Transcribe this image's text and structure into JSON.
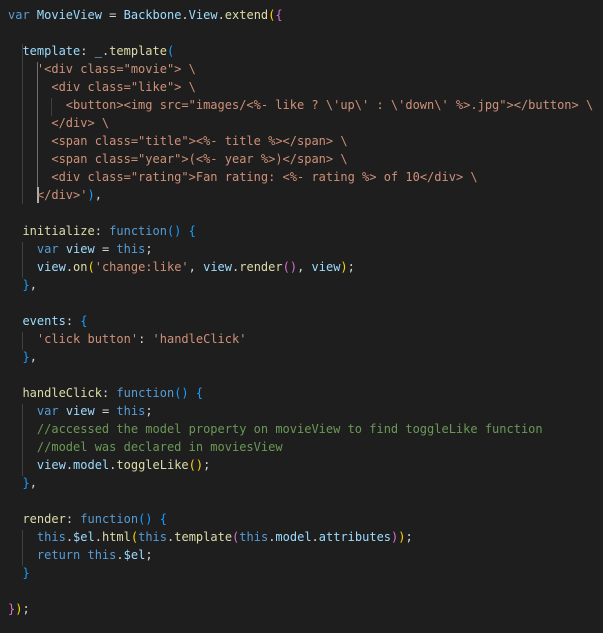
{
  "editor": {
    "language": "javascript",
    "theme": {
      "background": "#1e1e1e",
      "keyword": "#569cd6",
      "function": "#dcdcaa",
      "variable": "#9cdcfe",
      "string": "#ce9178",
      "comment": "#6a9955",
      "bracket_level1": "#ffd700",
      "bracket_level2": "#da70d6",
      "bracket_level3": "#179fff",
      "text": "#d4d4d4"
    },
    "lines": [
      [
        [
          "kw",
          "var "
        ],
        [
          "var",
          "MovieView"
        ],
        [
          "plain",
          " = "
        ],
        [
          "var",
          "Backbone"
        ],
        [
          "plain",
          "."
        ],
        [
          "var",
          "View"
        ],
        [
          "plain",
          "."
        ],
        [
          "fn",
          "extend"
        ],
        [
          "bracket",
          "("
        ],
        [
          "brace2",
          "{"
        ]
      ],
      [],
      [
        [
          "plain",
          "  "
        ],
        [
          "prop",
          "template"
        ],
        [
          "plain",
          ": "
        ],
        [
          "var",
          "_"
        ],
        [
          "plain",
          "."
        ],
        [
          "fn",
          "template"
        ],
        [
          "brace3",
          "("
        ]
      ],
      [
        [
          "plain",
          "    "
        ],
        [
          "str",
          "'<div class=\"movie\"> \\"
        ]
      ],
      [
        [
          "plain",
          "      "
        ],
        [
          "str",
          "<div class=\"like\"> \\"
        ]
      ],
      [
        [
          "plain",
          "        "
        ],
        [
          "str",
          "<button><img src=\"images/<%- like ? \\'up\\' : \\'down\\' %>.jpg\"></button> \\"
        ]
      ],
      [
        [
          "plain",
          "      "
        ],
        [
          "str",
          "</div> \\"
        ]
      ],
      [
        [
          "plain",
          "      "
        ],
        [
          "str",
          "<span class=\"title\"><%- title %></span> \\"
        ]
      ],
      [
        [
          "plain",
          "      "
        ],
        [
          "str",
          "<span class=\"year\">(<%- year %>)</span> \\"
        ]
      ],
      [
        [
          "plain",
          "      "
        ],
        [
          "str",
          "<div class=\"rating\">Fan rating: <%- rating %> of 10</div> \\"
        ]
      ],
      [
        [
          "plain",
          "    "
        ],
        [
          "str",
          "</div>'"
        ],
        [
          "brace3",
          ")"
        ],
        [
          "plain",
          ","
        ]
      ],
      [],
      [
        [
          "plain",
          "  "
        ],
        [
          "fn",
          "initialize"
        ],
        [
          "plain",
          ": "
        ],
        [
          "kw",
          "function"
        ],
        [
          "brace3",
          "()"
        ],
        [
          "plain",
          " "
        ],
        [
          "brace3",
          "{"
        ]
      ],
      [
        [
          "plain",
          "    "
        ],
        [
          "kw",
          "var "
        ],
        [
          "var",
          "view"
        ],
        [
          "plain",
          " = "
        ],
        [
          "kw",
          "this"
        ],
        [
          "plain",
          ";"
        ]
      ],
      [
        [
          "plain",
          "    "
        ],
        [
          "var",
          "view"
        ],
        [
          "plain",
          "."
        ],
        [
          "fn",
          "on"
        ],
        [
          "bracket",
          "("
        ],
        [
          "str",
          "'change:like'"
        ],
        [
          "plain",
          ", "
        ],
        [
          "var",
          "view"
        ],
        [
          "plain",
          "."
        ],
        [
          "fn",
          "render"
        ],
        [
          "brace2",
          "()"
        ],
        [
          "plain",
          ", "
        ],
        [
          "var",
          "view"
        ],
        [
          "bracket",
          ")"
        ],
        [
          "plain",
          ";"
        ]
      ],
      [
        [
          "plain",
          "  "
        ],
        [
          "brace3",
          "}"
        ],
        [
          "plain",
          ","
        ]
      ],
      [],
      [
        [
          "plain",
          "  "
        ],
        [
          "prop",
          "events"
        ],
        [
          "plain",
          ": "
        ],
        [
          "brace3",
          "{"
        ]
      ],
      [
        [
          "plain",
          "    "
        ],
        [
          "str",
          "'click button'"
        ],
        [
          "plain",
          ": "
        ],
        [
          "str",
          "'handleClick'"
        ]
      ],
      [
        [
          "plain",
          "  "
        ],
        [
          "brace3",
          "}"
        ],
        [
          "plain",
          ","
        ]
      ],
      [],
      [
        [
          "plain",
          "  "
        ],
        [
          "fn",
          "handleClick"
        ],
        [
          "plain",
          ": "
        ],
        [
          "kw",
          "function"
        ],
        [
          "brace3",
          "()"
        ],
        [
          "plain",
          " "
        ],
        [
          "brace3",
          "{"
        ]
      ],
      [
        [
          "plain",
          "    "
        ],
        [
          "kw",
          "var "
        ],
        [
          "var",
          "view"
        ],
        [
          "plain",
          " = "
        ],
        [
          "kw",
          "this"
        ],
        [
          "plain",
          ";"
        ]
      ],
      [
        [
          "plain",
          "    "
        ],
        [
          "cmt",
          "//accessed the model property on movieView to find toggleLike function"
        ]
      ],
      [
        [
          "plain",
          "    "
        ],
        [
          "cmt",
          "//model was declared in moviesView"
        ]
      ],
      [
        [
          "plain",
          "    "
        ],
        [
          "var",
          "view"
        ],
        [
          "plain",
          "."
        ],
        [
          "var",
          "model"
        ],
        [
          "plain",
          "."
        ],
        [
          "fn",
          "toggleLike"
        ],
        [
          "bracket",
          "()"
        ],
        [
          "plain",
          ";"
        ]
      ],
      [
        [
          "plain",
          "  "
        ],
        [
          "brace3",
          "}"
        ],
        [
          "plain",
          ","
        ]
      ],
      [],
      [
        [
          "plain",
          "  "
        ],
        [
          "fn",
          "render"
        ],
        [
          "plain",
          ": "
        ],
        [
          "kw",
          "function"
        ],
        [
          "brace3",
          "()"
        ],
        [
          "plain",
          " "
        ],
        [
          "brace3",
          "{"
        ]
      ],
      [
        [
          "plain",
          "    "
        ],
        [
          "kw",
          "this"
        ],
        [
          "plain",
          "."
        ],
        [
          "var",
          "$el"
        ],
        [
          "plain",
          "."
        ],
        [
          "fn",
          "html"
        ],
        [
          "bracket",
          "("
        ],
        [
          "kw",
          "this"
        ],
        [
          "plain",
          "."
        ],
        [
          "fn",
          "template"
        ],
        [
          "brace2",
          "("
        ],
        [
          "kw",
          "this"
        ],
        [
          "plain",
          "."
        ],
        [
          "var",
          "model"
        ],
        [
          "plain",
          "."
        ],
        [
          "var",
          "attributes"
        ],
        [
          "brace2",
          ")"
        ],
        [
          "bracket",
          ")"
        ],
        [
          "plain",
          ";"
        ]
      ],
      [
        [
          "plain",
          "    "
        ],
        [
          "kw",
          "return "
        ],
        [
          "kw",
          "this"
        ],
        [
          "plain",
          "."
        ],
        [
          "var",
          "$el"
        ],
        [
          "plain",
          ";"
        ]
      ],
      [
        [
          "plain",
          "  "
        ],
        [
          "brace3",
          "}"
        ]
      ],
      [],
      [
        [
          "brace2",
          "}"
        ],
        [
          "bracket",
          ")"
        ],
        [
          "plain",
          ";"
        ]
      ]
    ]
  }
}
